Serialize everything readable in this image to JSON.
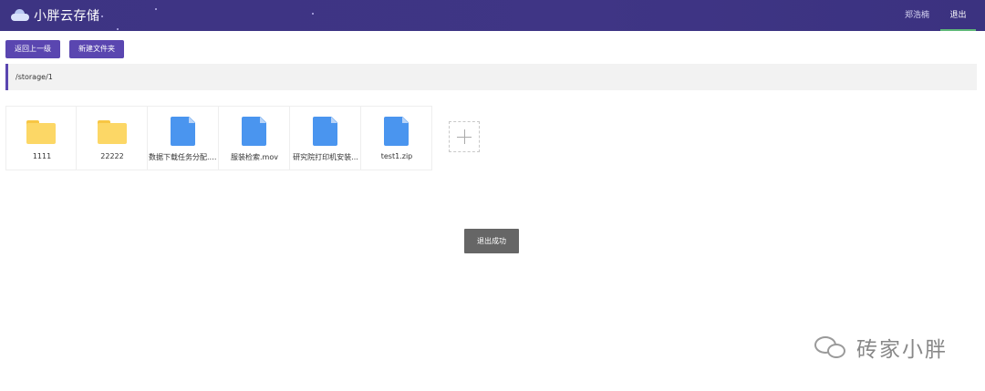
{
  "header": {
    "title": "小胖云存储",
    "user": "郑浩楠",
    "logout": "退出",
    "colors": {
      "background": "#3d3483",
      "active_underline": "#5fb878"
    }
  },
  "toolbar": {
    "back_label": "返回上一级",
    "new_folder_label": "新建文件夹"
  },
  "path": "/storage/1",
  "files": [
    {
      "name": "1111",
      "type": "folder"
    },
    {
      "name": "22222",
      "type": "folder"
    },
    {
      "name": "数据下载任务分配.zip",
      "type": "file"
    },
    {
      "name": "服装检索.mov",
      "type": "file"
    },
    {
      "name": "研究院打印机安装...",
      "type": "file"
    },
    {
      "name": "test1.zip",
      "type": "file"
    }
  ],
  "add_icon": "plus-icon",
  "toast": "退出成功",
  "watermark": {
    "icon": "wechat-icon",
    "text": "砖家小胖"
  },
  "colors": {
    "accent": "#5a46b0",
    "folder": "#fcd766",
    "file": "#4a95ef"
  }
}
